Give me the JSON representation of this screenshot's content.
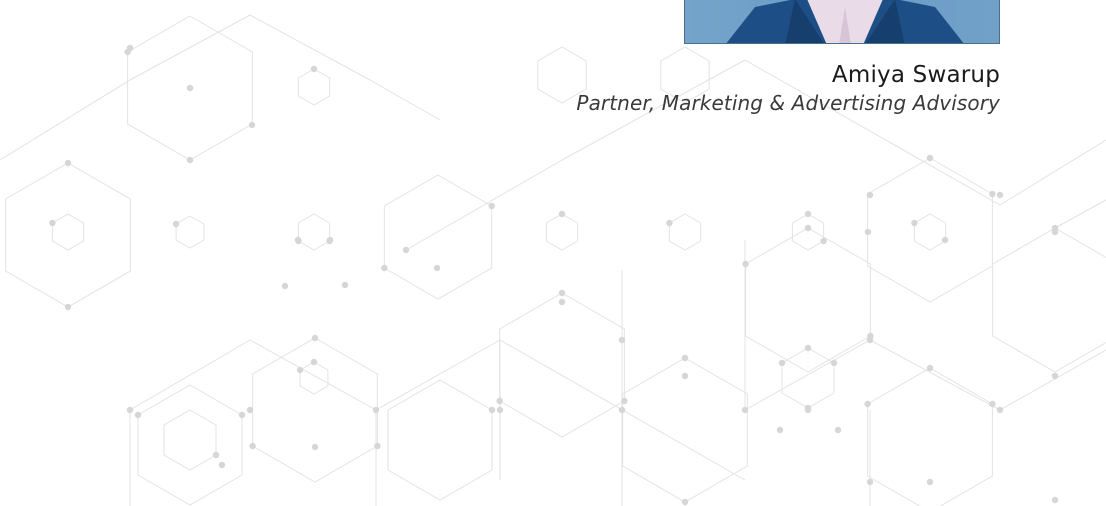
{
  "profile": {
    "name": "Amiya Swarup",
    "title": "Partner, Marketing & Advertising Advisory"
  },
  "colors": {
    "pattern_line": "#e3e3e3",
    "pattern_node": "#d6d6d6",
    "name_text": "#1a1a1a",
    "title_text": "#3a3a3a",
    "photo_bg": "#5a8fbc",
    "jacket": "#1d4f86",
    "shirt": "#e9d7e6"
  }
}
